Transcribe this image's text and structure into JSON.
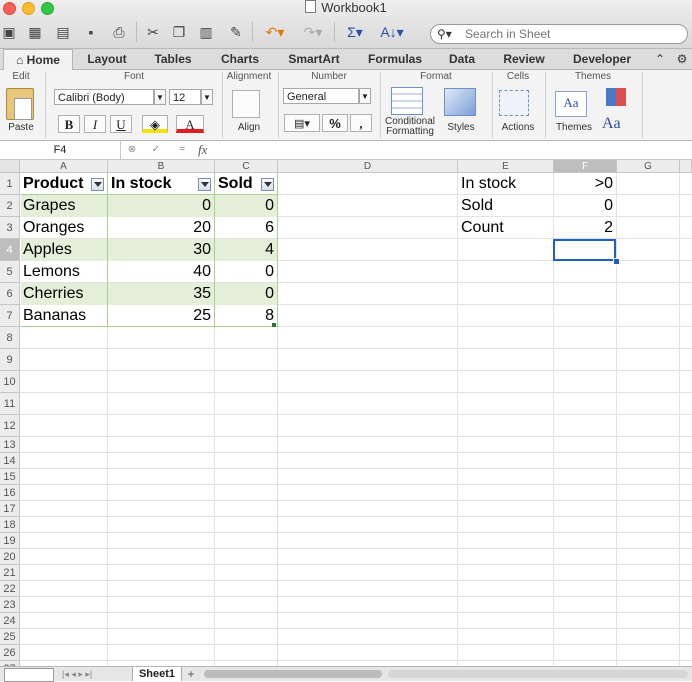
{
  "window": {
    "title": "Workbook1"
  },
  "search": {
    "placeholder": "Search in Sheet"
  },
  "ribbon_tabs": [
    "Home",
    "Layout",
    "Tables",
    "Charts",
    "SmartArt",
    "Formulas",
    "Data",
    "Review",
    "Developer"
  ],
  "ribbon_groups": {
    "edit": "Edit",
    "font": "Font",
    "alignment": "Alignment",
    "number": "Number",
    "format": "Format",
    "cells": "Cells",
    "themes": "Themes"
  },
  "ribbon_controls": {
    "paste": "Paste",
    "font_name": "Calibri (Body)",
    "font_size": "12",
    "bold": "B",
    "italic": "I",
    "underline": "U",
    "align": "Align",
    "number_format": "General",
    "percent": "%",
    "comma": ",",
    "conditional_formatting_1": "Conditional",
    "conditional_formatting_2": "Formatting",
    "styles": "Styles",
    "actions": "Actions",
    "themes": "Themes",
    "theme_fonts": "Aa"
  },
  "formula_bar": {
    "name_box": "F4",
    "fx": "fx",
    "formula": ""
  },
  "columns": [
    "A",
    "B",
    "C",
    "D",
    "E",
    "F",
    "G"
  ],
  "rows": [
    "1",
    "2",
    "3",
    "4",
    "5",
    "6",
    "7",
    "8",
    "9",
    "10",
    "11",
    "12",
    "13",
    "14",
    "15",
    "16",
    "17",
    "18",
    "19",
    "20",
    "21",
    "22",
    "23",
    "24",
    "25",
    "26",
    "27"
  ],
  "table": {
    "headers": [
      "Product",
      "In stock",
      "Sold"
    ],
    "rows": [
      [
        "Grapes",
        "0",
        "0"
      ],
      [
        "Oranges",
        "20",
        "6"
      ],
      [
        "Apples",
        "30",
        "4"
      ],
      [
        "Lemons",
        "40",
        "0"
      ],
      [
        "Cherries",
        "35",
        "0"
      ],
      [
        "Bananas",
        "25",
        "8"
      ]
    ]
  },
  "criteria": [
    [
      "In stock",
      ">0"
    ],
    [
      "Sold",
      "0"
    ],
    [
      "Count",
      "2"
    ]
  ],
  "selected_cell": "F4",
  "sheet_tabs": [
    "Sheet1"
  ],
  "add_sheet": "+",
  "colors": {
    "table_band": "#e3efd9",
    "table_border": "#a9d08e",
    "selection": "#1f5fbf"
  }
}
